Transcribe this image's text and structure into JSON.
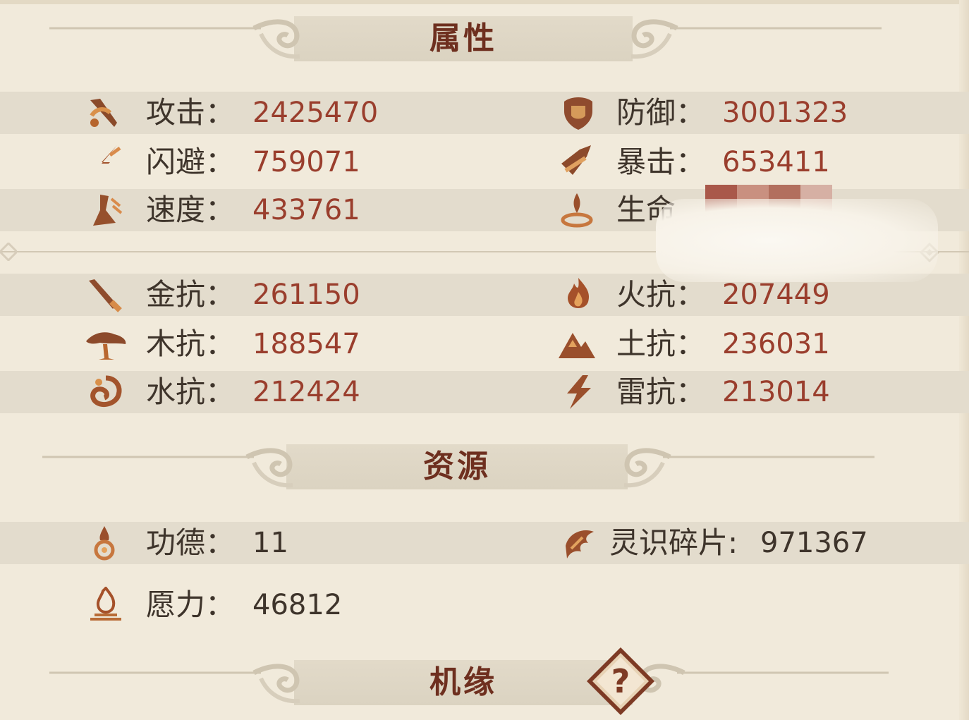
{
  "sections": {
    "attributes": "属性",
    "resources": "资源",
    "opportunity": "机缘"
  },
  "stats": {
    "attack": {
      "label": "攻击：",
      "value": "2425470",
      "icon": "attack-icon"
    },
    "defense": {
      "label": "防御：",
      "value": "3001323",
      "icon": "defense-icon"
    },
    "dodge": {
      "label": "闪避：",
      "value": "759071",
      "icon": "dodge-icon"
    },
    "crit": {
      "label": "暴击：",
      "value": "653411",
      "icon": "crit-icon"
    },
    "speed": {
      "label": "速度：",
      "value": "433761",
      "icon": "speed-icon"
    },
    "life": {
      "label": "生命",
      "value": "",
      "icon": "life-icon"
    }
  },
  "resists": {
    "metal": {
      "label": "金抗：",
      "value": "261150",
      "icon": "metal-sword-icon"
    },
    "fire": {
      "label": "火抗：",
      "value": "207449",
      "icon": "fire-icon"
    },
    "wood": {
      "label": "木抗：",
      "value": "188547",
      "icon": "tree-icon"
    },
    "earth": {
      "label": "土抗：",
      "value": "236031",
      "icon": "mountain-icon"
    },
    "water": {
      "label": "水抗：",
      "value": "212424",
      "icon": "water-swirl-icon"
    },
    "thunder": {
      "label": "雷抗：",
      "value": "213014",
      "icon": "lightning-icon"
    }
  },
  "resources": {
    "merit": {
      "label": "功德：",
      "value": "11",
      "icon": "merit-icon"
    },
    "shards": {
      "label": "灵识碎片:",
      "value": "971367",
      "icon": "spirit-shard-icon"
    },
    "wish": {
      "label": "愿力：",
      "value": "46812",
      "icon": "wish-flame-icon"
    }
  },
  "help": {
    "glyph": "?",
    "icon": "question-mark-icon"
  },
  "colors": {
    "background": "#f1eadb",
    "band": "#e3dccd",
    "value": "#9a3e2d",
    "label": "#3e342b",
    "title": "#6e2f1f"
  }
}
